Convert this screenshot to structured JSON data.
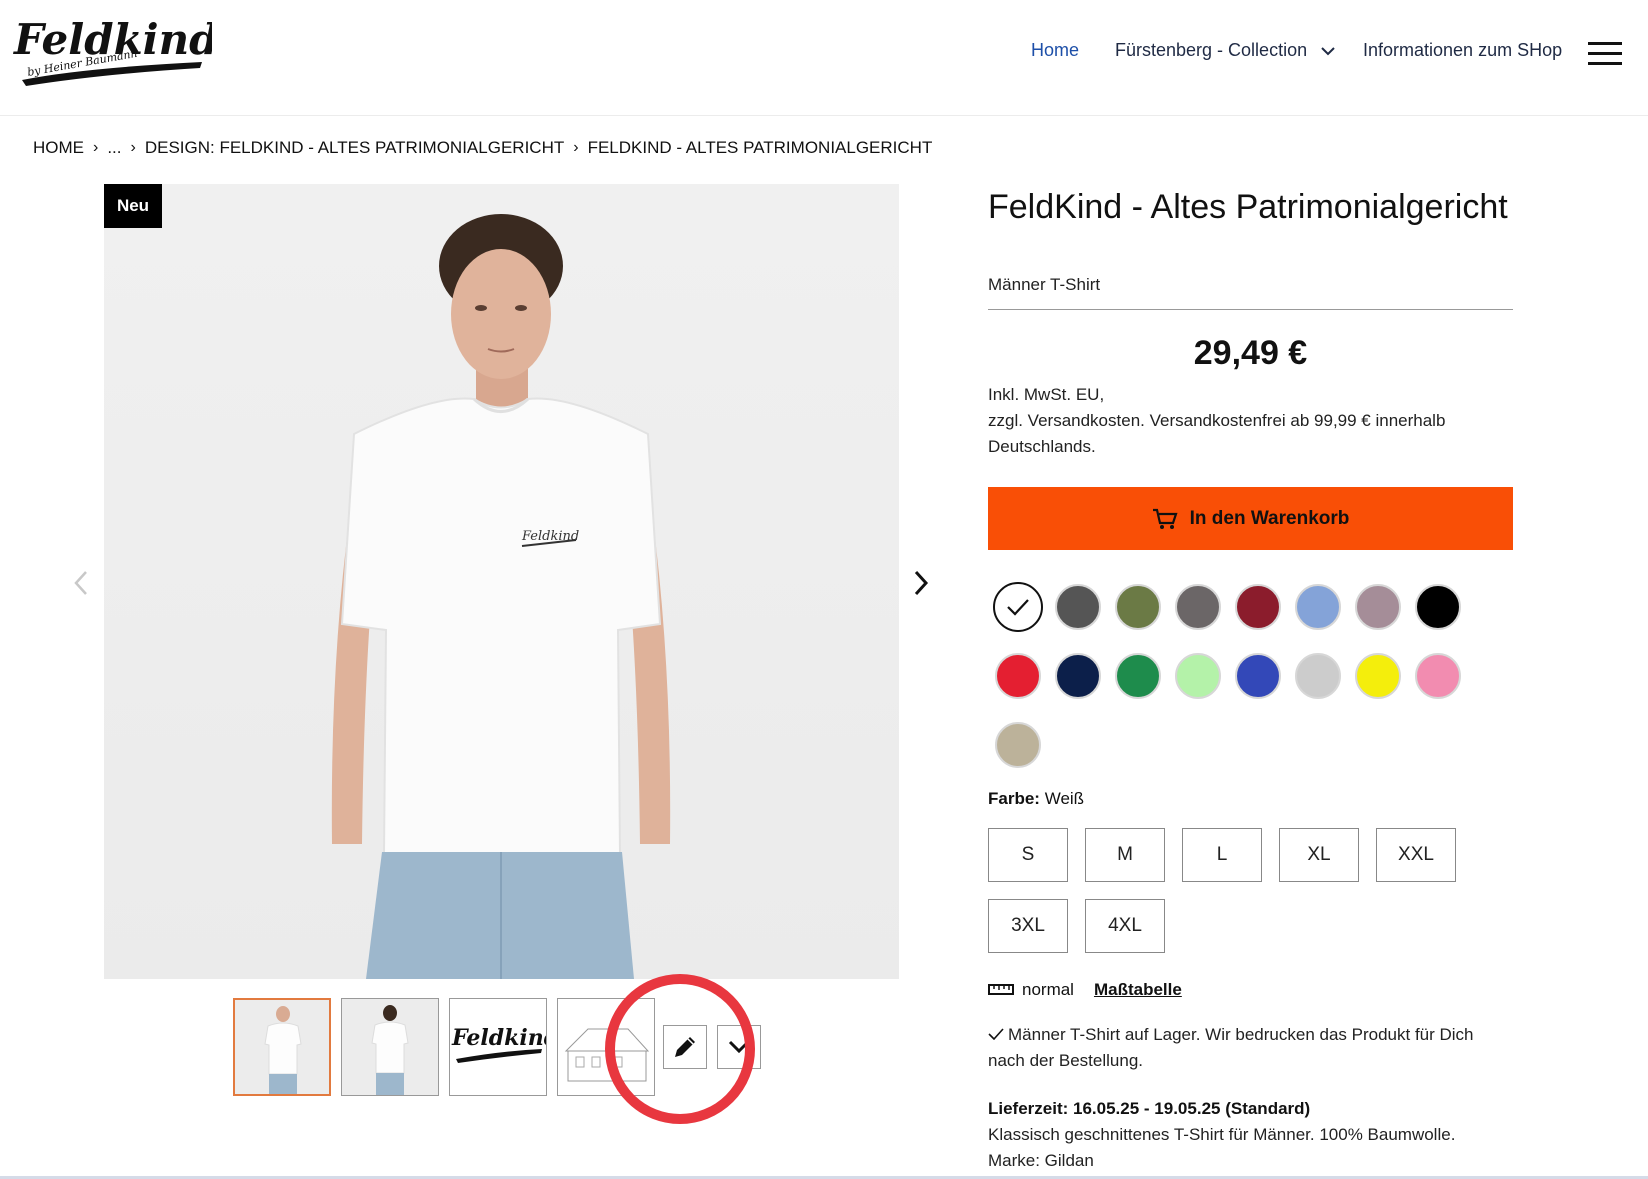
{
  "header": {
    "logo_text": "Feldkind",
    "logo_subtext": "by Heiner Baumann",
    "nav": {
      "home": "Home",
      "collection": "Fürstenberg - Collection",
      "info": "Informationen zum SHop"
    }
  },
  "breadcrumb": {
    "items": [
      "HOME",
      "...",
      "DESIGN: FELDKIND - ALTES PATRIMONIALGERICHT",
      "FELDKIND - ALTES PATRIMONIALGERICHT"
    ]
  },
  "gallery": {
    "badge": "Neu",
    "shirt_print": "Feldkind",
    "thumb_logo_text": "Feldkind"
  },
  "product": {
    "title": "FeldKind - Altes Patrimonialgericht",
    "subtitle": "Männer T-Shirt",
    "price": "29,49 €",
    "tax_line1": "Inkl. MwSt. EU,",
    "tax_line2": "zzgl. Versandkosten. Versandkostenfrei ab 99,99 € innerhalb Deutschlands.",
    "cart_label": "In den Warenkorb",
    "color_label": "Farbe:",
    "color_value": "Weiß",
    "colors": [
      "#ffffff",
      "#555555",
      "#6b7a45",
      "#6b6667",
      "#8b1c2c",
      "#84a3d8",
      "#a58d98",
      "#000000",
      "#e41f31",
      "#0c1f4a",
      "#1e8c4c",
      "#b4f2a9",
      "#3348b8",
      "#cccccc",
      "#f4ee0c",
      "#f28cb0",
      "#bcb29a"
    ],
    "sizes": [
      "S",
      "M",
      "L",
      "XL",
      "XXL",
      "3XL",
      "4XL"
    ],
    "fit_label": "normal",
    "size_chart_link": "Maßtabelle",
    "stock_text": "Männer T-Shirt auf Lager. Wir bedrucken das Produkt für Dich nach der Bestellung.",
    "delivery_label": "Lieferzeit: 16.05.25 - 19.05.25 (Standard)",
    "description": "Klassisch geschnittenes T-Shirt für Männer. 100% Baumwolle.",
    "brand": "Marke: Gildan"
  },
  "colors": {
    "accent_cart": "#f94f06",
    "nav_active": "#1d4fa8",
    "highlight": "#e8373f",
    "thumb_active": "#e27a3f"
  }
}
